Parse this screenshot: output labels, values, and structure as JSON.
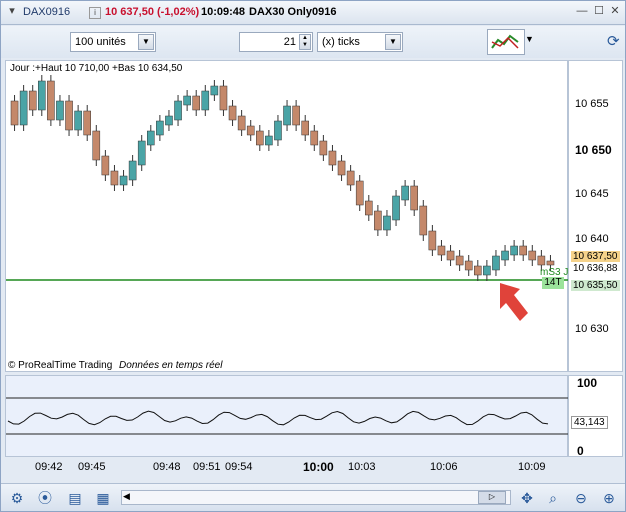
{
  "title": {
    "symbol": "DAX0916",
    "price_change": "10 637,50 (-1,02%)",
    "time": "10:09:48",
    "instrument": "DAX30 Only0916"
  },
  "toolbar": {
    "units": "100 unités",
    "period_value": "21",
    "period_type": "(x) ticks"
  },
  "chart": {
    "header": "Jour :+Haut 10 710,00 +Bas 10 634,50",
    "credit": "© ProRealTime Trading",
    "credit_sub": "Données en temps réel",
    "price_ticks": [
      "10 655",
      "10 650",
      "10 645",
      "10 640",
      "10 635",
      "10 630"
    ],
    "price_tags": {
      "last": "10 637,50",
      "bid": "10 636,88",
      "line": "10 635,50",
      "count": "14T"
    },
    "hline_label": "mS3 J",
    "time_ticks": [
      "09:42",
      "09:45",
      "09:48",
      "09:51",
      "09:54",
      "10:00",
      "10:03",
      "10:06",
      "10:09"
    ],
    "osc_ticks": [
      "100",
      "0"
    ],
    "osc_value": "43,143"
  },
  "colors": {
    "up": "#4aa4a6",
    "down": "#c4886a",
    "hline": "#1f8a1f",
    "arrow": "#e0433a"
  },
  "icons": [
    "chart-settings-icon",
    "indicator-icon",
    "compare-icon",
    "draw-icon",
    "scroll-left-icon",
    "scroll-right-icon",
    "zoom-in-icon",
    "zoom-out-icon"
  ]
}
